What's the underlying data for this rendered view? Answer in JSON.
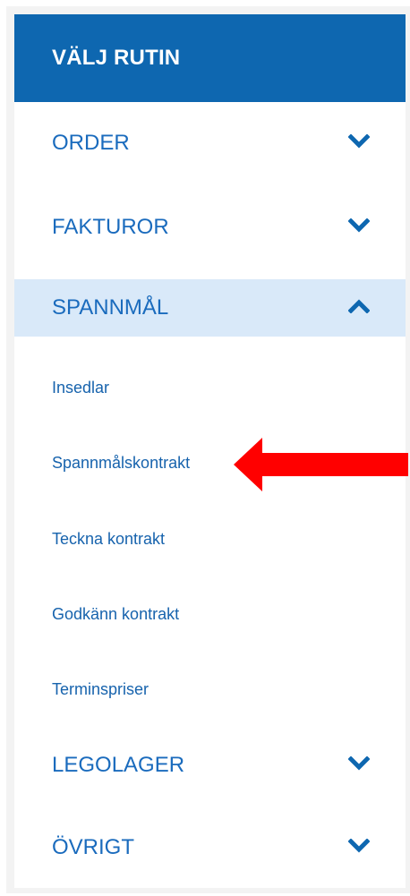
{
  "menu": {
    "header": "VÄLJ RUTIN",
    "categories": {
      "order": {
        "label": "ORDER",
        "icon": "chevron-down-icon",
        "expanded": false
      },
      "fakturor": {
        "label": "FAKTUROR",
        "icon": "chevron-down-icon",
        "expanded": false
      },
      "spannmal": {
        "label": "SPANNMÅL",
        "icon": "chevron-up-icon",
        "expanded": true
      },
      "legolager": {
        "label": "LEGOLAGER",
        "icon": "chevron-down-icon",
        "expanded": false
      },
      "ovrigt": {
        "label": "ÖVRIGT",
        "icon": "chevron-down-icon",
        "expanded": false
      }
    },
    "spannmal_items": [
      "Insedlar",
      "Spannmålskontrakt",
      "Teckna kontrakt",
      "Godkänn kontrakt",
      "Terminspriser"
    ]
  },
  "annotation": {
    "icon": "red-arrow-icon",
    "target": "Spannmålskontrakt",
    "color": "#ff0000"
  },
  "colors": {
    "header_bg": "#0e67b0",
    "active_bg": "#d9e9f9",
    "link": "#1a6bbd"
  }
}
